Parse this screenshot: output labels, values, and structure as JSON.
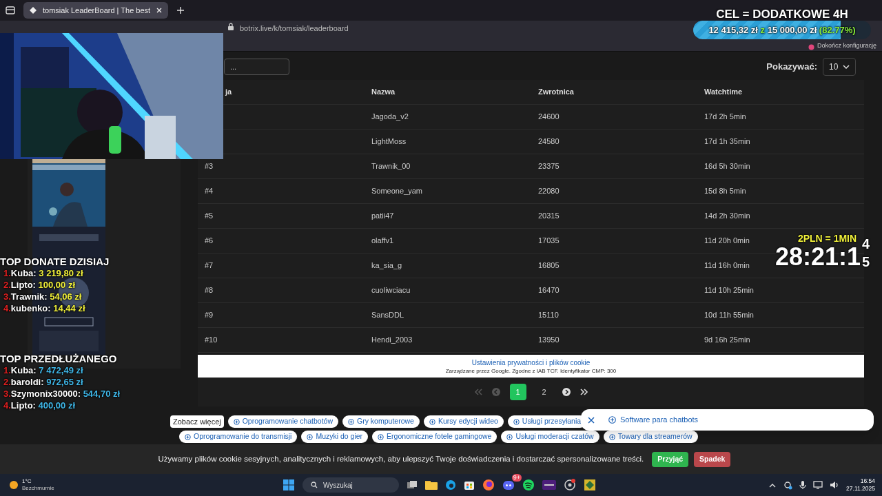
{
  "browser": {
    "tab_title": "tomsiak LeaderBoard | The best",
    "url": "botrix.live/k/tomsiak/leaderboard",
    "setup_prompt": "Dokończ konfigurację"
  },
  "page": {
    "search_placeholder": "...",
    "show_label": "Pokazywać:",
    "show_value": "10",
    "table": {
      "columns": [
        "ja",
        "Nazwa",
        "Zwrotnica",
        "Watchtime"
      ],
      "rows": [
        {
          "name": "Jagoda_v2",
          "points": "24600",
          "watchtime": "17d 2h 5min"
        },
        {
          "name": "LightMoss",
          "points": "24580",
          "watchtime": "17d 1h 35min"
        },
        {
          "position": "#3",
          "name": "Trawnik_00",
          "points": "23375",
          "watchtime": "16d 5h 30min"
        },
        {
          "position": "#4",
          "name": "Someone_yam",
          "points": "22080",
          "watchtime": "15d 8h 5min"
        },
        {
          "position": "#5",
          "name": "patii47",
          "points": "20315",
          "watchtime": "14d 2h 30min"
        },
        {
          "position": "#6",
          "name": "olaffv1",
          "points": "17035",
          "watchtime": "11d 20h 0min"
        },
        {
          "position": "#7",
          "name": "ka_sia_g",
          "points": "16805",
          "watchtime": "11d 16h 0min"
        },
        {
          "position": "#8",
          "name": "cuoliwciacu",
          "points": "16470",
          "watchtime": "11d 10h 25min"
        },
        {
          "position": "#9",
          "name": "SansDDL",
          "points": "15110",
          "watchtime": "10d 11h 55min"
        },
        {
          "position": "#10",
          "name": "Hendi_2003",
          "points": "13950",
          "watchtime": "9d 16h 25min"
        }
      ]
    },
    "consent_banner": {
      "title": "Ustawienia prywatności i plików cookie",
      "subtitle": "Zarządzane przez Google. Zgodne z IAB TCF. Identyfikator CMP: 300"
    },
    "pagination": {
      "pages": [
        {
          "label": "1",
          "selected": true
        },
        {
          "label": "2",
          "selected": false
        }
      ]
    },
    "see_more": "Zobacz więcej",
    "chips": [
      [
        "Oprogramowanie chatbotów",
        "Gry komputerowe",
        "Kursy edycji wideo",
        "Usługi przesyłania"
      ],
      [
        "Oprogramowanie do transmisji",
        "Muzyki do gier",
        "Ergonomiczne fotele gamingowe",
        "Usługi moderacji czatów",
        "Towary dla streamerów"
      ]
    ],
    "chip_popup": "Software para chatbots"
  },
  "cookie_bar": {
    "text": "Używamy plików cookie sesyjnych, analitycznych i reklamowych, aby ulepszyć Twoje doświadczenia i dostarczać spersonalizowane treści.",
    "accept": "Przyjąć",
    "decline": "Spadek"
  },
  "overlays": {
    "goal": {
      "title": "CEL = DODATKOWE 4H",
      "current": "12 415,32 zł",
      "separator": "z",
      "target": "15 000,00 zł",
      "percent": "(82.77%)",
      "level": 0.83
    },
    "timer": {
      "rate": "2PLN = 1MIN",
      "time": "28:21:1",
      "overflow": [
        "4",
        "5"
      ]
    },
    "top_donations": {
      "title": "TOP DONATE DZISIAJ",
      "entries": [
        {
          "rank": "1.",
          "name": "Kuba:",
          "amount": "3 219,80 zł"
        },
        {
          "rank": "2.",
          "name": "Lipto:",
          "amount": "100,00 zł"
        },
        {
          "rank": "3.",
          "name": "Trawnik:",
          "amount": "54,06 zł"
        },
        {
          "rank": "4.",
          "name": "kubenko:",
          "amount": "14,44 zł"
        }
      ]
    },
    "top_extended": {
      "title": "TOP PRZEDŁUŻANEGO",
      "entries": [
        {
          "rank": "1.",
          "name": "Kuba:",
          "amount": "7 472,49 zł"
        },
        {
          "rank": "2.",
          "name": "baroldi:",
          "amount": "972,65 zł"
        },
        {
          "rank": "3.",
          "name": "Szymonix30000:",
          "amount": "544,70 zł"
        },
        {
          "rank": "4.",
          "name": "Lipto:",
          "amount": "400,00 zł"
        }
      ]
    }
  },
  "taskbar": {
    "weather_temp": "1°C",
    "weather_text": "Bezchmurnie",
    "search_placeholder": "Wyszukaj",
    "discord_badge": "9+",
    "time": "16:54",
    "date": "27.11.2025"
  }
}
